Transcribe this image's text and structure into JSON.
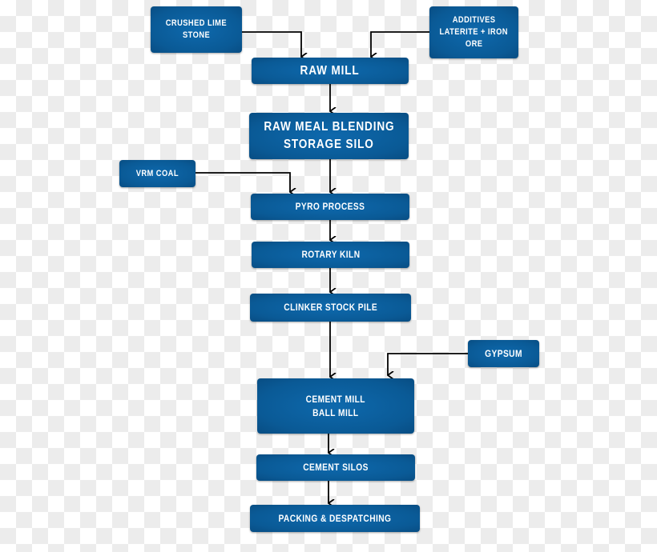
{
  "nodes": {
    "crushed_lime_stone": [
      "CRUSHED LIME",
      "STONE"
    ],
    "additives": [
      "ADDITIVES",
      "LATERITE + IRON",
      "ORE"
    ],
    "raw_mill": [
      "RAW MILL"
    ],
    "raw_meal_blending": [
      "RAW MEAL BLENDING",
      "STORAGE SILO"
    ],
    "vrm_coal": [
      "VRM COAL"
    ],
    "pyro_process": [
      "PYRO PROCESS"
    ],
    "rotary_kiln": [
      "ROTARY KILN"
    ],
    "clinker_stock_pile": [
      "CLINKER STOCK PILE"
    ],
    "gypsum": [
      "GYPSUM"
    ],
    "cement_mill": [
      "CEMENT MILL",
      "BALL MILL"
    ],
    "cement_silos": [
      "CEMENT SILOS"
    ],
    "packing": [
      "PACKING & DESPATCHING"
    ]
  },
  "edges": [
    [
      "crushed_lime_stone",
      "raw_mill"
    ],
    [
      "additives",
      "raw_mill"
    ],
    [
      "raw_mill",
      "raw_meal_blending"
    ],
    [
      "raw_meal_blending",
      "pyro_process"
    ],
    [
      "vrm_coal",
      "pyro_process"
    ],
    [
      "pyro_process",
      "rotary_kiln"
    ],
    [
      "rotary_kiln",
      "clinker_stock_pile"
    ],
    [
      "clinker_stock_pile",
      "cement_mill"
    ],
    [
      "gypsum",
      "cement_mill"
    ],
    [
      "cement_mill",
      "cement_silos"
    ],
    [
      "cement_silos",
      "packing"
    ]
  ],
  "colors": {
    "box": "#0a5a96",
    "text": "#ffffff",
    "arrow": "#000000"
  }
}
